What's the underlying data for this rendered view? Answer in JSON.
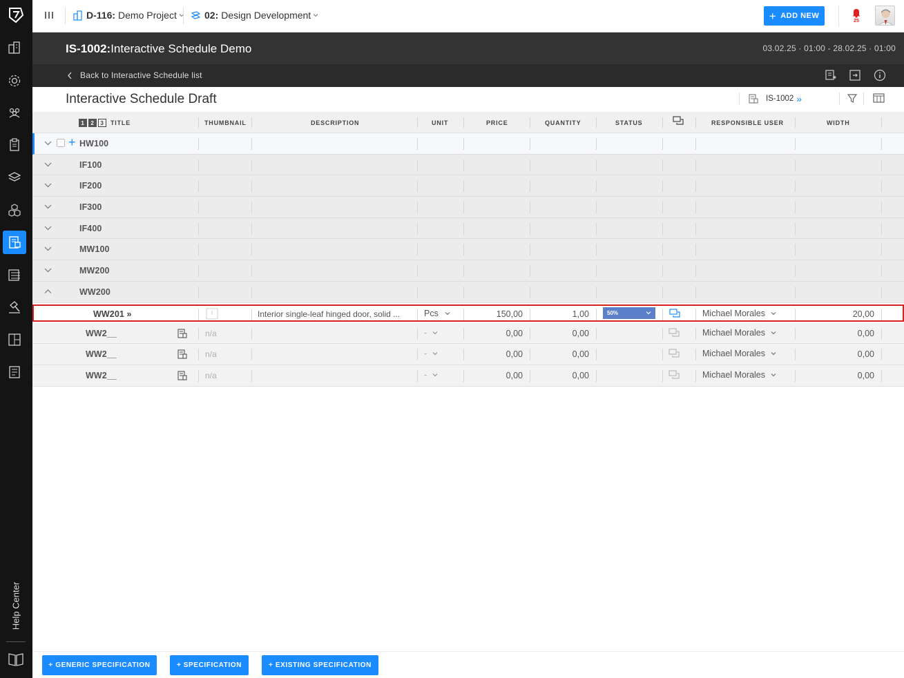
{
  "sidebar": {
    "help_center": "Help Center"
  },
  "topbar": {
    "project_code": "D-116:",
    "project_name": "Demo Project",
    "phase_code": "02:",
    "phase_name": "Design Development",
    "add_new": "ADD NEW",
    "notification_count": "25"
  },
  "header": {
    "code": "IS-1002:",
    "title": "Interactive Schedule Demo",
    "dates": "03.02.25 · 01:00 - 28.02.25 · 01:00",
    "back": "Back to Interactive Schedule list"
  },
  "draft": {
    "title": "Interactive Schedule Draft",
    "ref": "IS-1002",
    "ref_chevron": "»"
  },
  "table": {
    "levels": [
      "1",
      "2",
      "3"
    ],
    "columns": {
      "title": "TITLE",
      "thumbnail": "THUMBNAIL",
      "description": "DESCRIPTION",
      "unit": "UNIT",
      "price": "PRICE",
      "quantity": "QUANTITY",
      "status": "STATUS",
      "responsible_user": "RESPONSIBLE USER",
      "width": "WIDTH"
    },
    "hw_row": {
      "title": "HW100"
    },
    "groups": [
      "IF100",
      "IF200",
      "IF300",
      "IF400",
      "MW100",
      "MW200",
      "WW200"
    ],
    "item": {
      "title": "WW201",
      "chevron": "»",
      "description": "Interior single-leaf hinged door, solid ...",
      "unit": "Pcs",
      "price": "150,00",
      "quantity": "1,00",
      "status": "50%",
      "responsible": "Michael Morales",
      "width": "20,00"
    },
    "subrows": [
      {
        "title": "WW2__",
        "thumbnail": "n/a",
        "unit": "-",
        "price": "0,00",
        "quantity": "0,00",
        "responsible": "Michael Morales",
        "width": "0,00"
      },
      {
        "title": "WW2__",
        "thumbnail": "n/a",
        "unit": "-",
        "price": "0,00",
        "quantity": "0,00",
        "responsible": "Michael Morales",
        "width": "0,00"
      },
      {
        "title": "WW2__",
        "thumbnail": "n/a",
        "unit": "-",
        "price": "0,00",
        "quantity": "0,00",
        "responsible": "Michael Morales",
        "width": "0,00"
      }
    ]
  },
  "footer": {
    "generic_spec": "+ GENERIC SPECIFICATION",
    "spec": "+ SPECIFICATION",
    "existing_spec": "+ EXISTING SPECIFICATION"
  },
  "colors": {
    "accent": "#1a8cff",
    "header_dark": "#333333",
    "status_fill": "#5b7fc9",
    "highlight_border": "#d92121"
  }
}
